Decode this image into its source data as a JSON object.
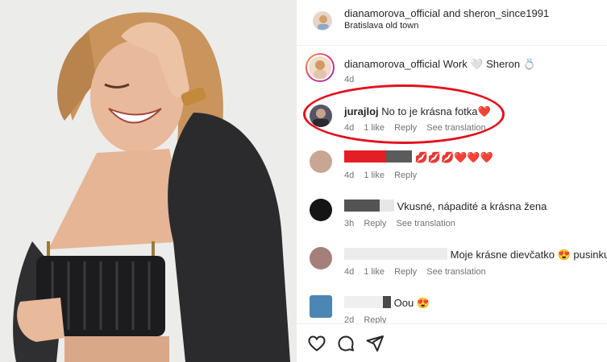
{
  "header": {
    "title": "dianamorova_official and sheron_since1991",
    "location": "Bratislava old town"
  },
  "caption": {
    "user": "dianamorova_official",
    "text": "Work 🤍 Sheron 💍",
    "time": "4d"
  },
  "comments": [
    {
      "user": "jurajloj",
      "text": "No to je krásna fotka❤️",
      "time": "4d",
      "likes": "1 like",
      "reply": "Reply",
      "translate": "See translation"
    },
    {
      "user": "",
      "text": "💋💋💋❤️❤️❤️",
      "time": "4d",
      "likes": "1 like",
      "reply": "Reply"
    },
    {
      "user": "",
      "text": "Vkusné, nápadité a krásna žena",
      "time": "3h",
      "reply": "Reply",
      "translate": "See translation"
    },
    {
      "user": "",
      "text": "Moje krásne dievčatko 😍 pusinku t",
      "time": "4d",
      "likes": "1 like",
      "reply": "Reply",
      "translate": "See translation"
    },
    {
      "user": "",
      "text": "Oou 😍",
      "time": "2d",
      "reply": "Reply"
    }
  ],
  "icons": [
    "heart-icon",
    "comment-icon",
    "share-icon"
  ]
}
